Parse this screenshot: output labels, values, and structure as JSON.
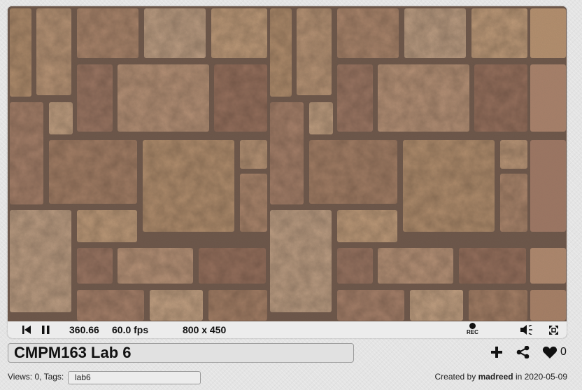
{
  "player": {
    "time": "360.66",
    "fps": "60.0 fps",
    "resolution": "800 x 450",
    "rec_label": "REC",
    "canvas_content": "stone-wall-texture"
  },
  "shader": {
    "title": "CMPM163 Lab 6",
    "likes": "0",
    "views_label": "Views: 0, Tags:",
    "tags": "lab6",
    "created_by_prefix": "Created by",
    "author": "madreed",
    "created_in": "in 2020-05-09"
  },
  "icons": {
    "rewind": "skip-back-icon",
    "pause": "pause-icon",
    "record": "record-icon",
    "volume": "volume-icon",
    "fullscreen": "fullscreen-icon",
    "add": "plus-icon",
    "share": "share-icon",
    "like": "heart-icon"
  }
}
